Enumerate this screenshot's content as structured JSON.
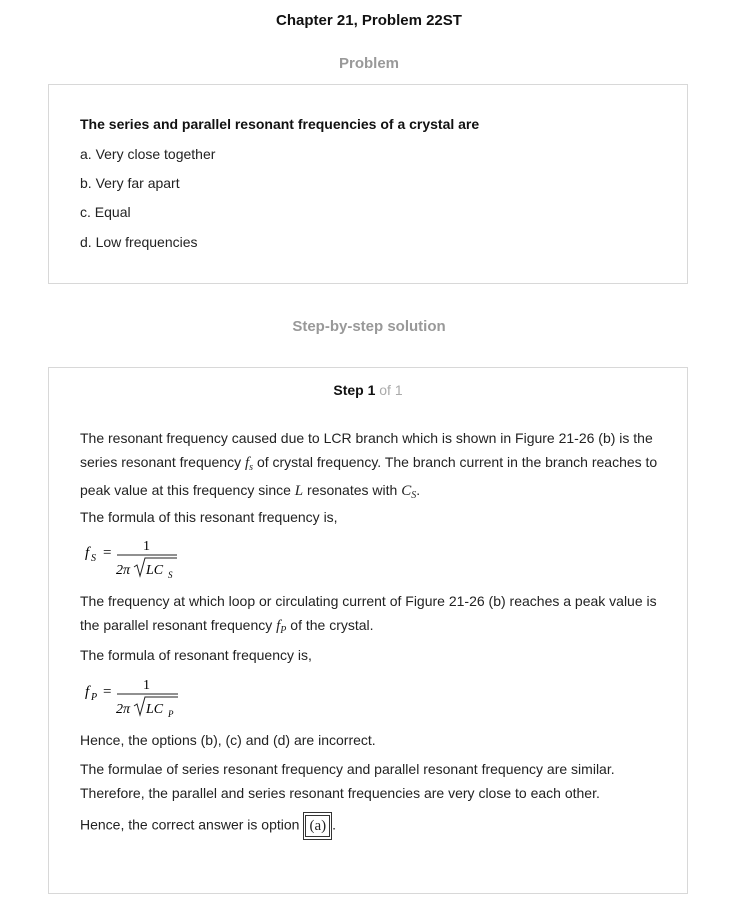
{
  "header": {
    "title": "Chapter 21, Problem 22ST"
  },
  "problem": {
    "heading": "Problem",
    "question": "The series and parallel resonant frequencies of a crystal are",
    "options": [
      "a. Very close together",
      "b. Very far apart",
      "c. Equal",
      "d. Low frequencies"
    ]
  },
  "solution": {
    "heading": "Step-by-step solution",
    "step_label": "Step 1",
    "step_of": "of 1",
    "p1_a": "The resonant frequency caused due to LCR branch which is shown in Figure 21-26 (b) is the series resonant frequency ",
    "p1_var_f": "f",
    "p1_var_f_sub": "s",
    "p1_b": "of crystal frequency. The branch current in the branch reaches to peak value at this frequency since ",
    "p1_var_L": "L",
    "p1_c": "resonates with ",
    "p1_var_C": "C",
    "p1_var_C_sub": "S",
    "p1_d": ".",
    "p2": "The formula of this resonant frequency is,",
    "formula1": {
      "lhs": "f",
      "lhs_sub": "S",
      "num": "1",
      "den_pre": "2π",
      "den_rad": "LC",
      "den_sub": "S"
    },
    "p3_a": "The frequency at which loop or circulating current of Figure 21-26 (b) reaches a peak value is the parallel resonant frequency ",
    "p3_var_f": "f",
    "p3_var_f_sub": "P",
    "p3_b": "of the crystal.",
    "p4": "The formula of resonant frequency is,",
    "formula2": {
      "lhs": "f",
      "lhs_sub": "P",
      "num": "1",
      "den_pre": "2π",
      "den_rad": "LC",
      "den_sub": "P"
    },
    "p5": "Hence, the options (b), (c) and (d) are incorrect.",
    "p6": "The formulae of series resonant frequency and parallel resonant frequency are similar. Therefore, the parallel and series resonant frequencies are very close to each other.",
    "p7": "Hence, the correct answer is option",
    "answer": "(a)",
    "p7_end": "."
  }
}
